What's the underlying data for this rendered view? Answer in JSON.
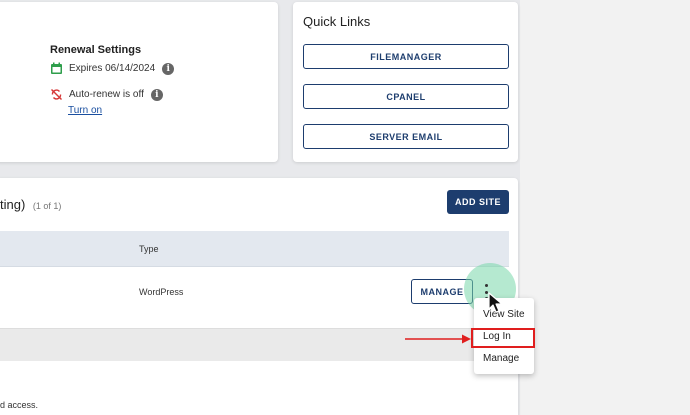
{
  "renewal": {
    "title": "Renewal Settings",
    "expires": "Expires 06/14/2024",
    "autorenew": "Auto-renew is off",
    "turn_on": "Turn on",
    "info_glyph": "i"
  },
  "quick_links": {
    "title": "Quick Links",
    "buttons": [
      "FILEMANAGER",
      "CPANEL",
      "SERVER EMAIL"
    ]
  },
  "sites": {
    "title": "ting)",
    "count": "(1 of 1)",
    "add_site": "ADD SITE",
    "column_type": "Type",
    "row_type": "WordPress",
    "manage": "MANAGE",
    "footer_note": "d access."
  },
  "menu": {
    "items": [
      "View Site",
      "Log In",
      "Manage"
    ]
  },
  "colors": {
    "primary": "#1d3d6e",
    "link": "#1a4fa0",
    "highlight": "#e01e1e",
    "halo": "#78d7aa"
  },
  "icons": [
    "calendar-icon",
    "autorenew-off-icon",
    "info-icon",
    "kebab-icon",
    "cursor-icon",
    "arrow-icon"
  ]
}
